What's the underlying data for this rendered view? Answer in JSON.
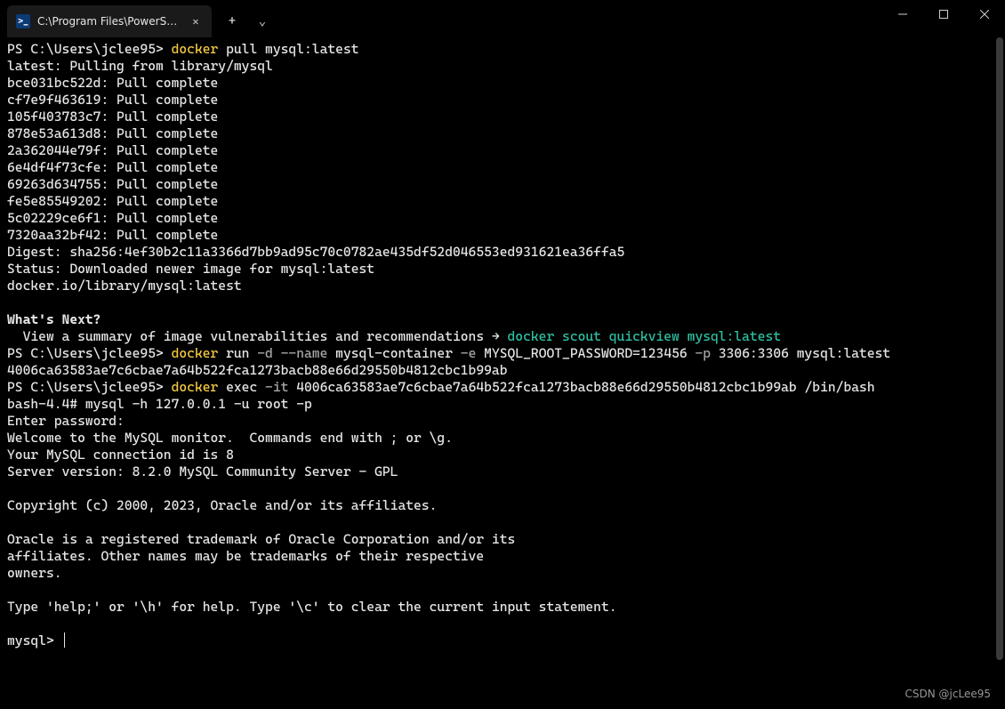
{
  "window": {
    "tab_title": "C:\\Program Files\\PowerShell\\",
    "new_tab_tooltip": "+",
    "dropdown_tooltip": "⌄"
  },
  "icons": {
    "ps_label": ">_",
    "close_x": "✕",
    "plus": "+",
    "chevron_down": "⌄"
  },
  "colors": {
    "background": "#000000",
    "text": "#e6e6e6",
    "cmd": "#f2c744",
    "flag": "#a7a7a7",
    "scout": "#2ec0a3"
  },
  "terminal": {
    "prompt": "PS C:\\Users\\jclee95> ",
    "cmd_docker": "docker",
    "cmd1_rest": " pull mysql:latest",
    "l2": "latest: Pulling from library/mysql",
    "layers": [
      "bce031bc522d: Pull complete",
      "cf7e9f463619: Pull complete",
      "105f403783c7: Pull complete",
      "878e53a613d8: Pull complete",
      "2a362044e79f: Pull complete",
      "6e4df4f73cfe: Pull complete",
      "69263d634755: Pull complete",
      "fe5e85549202: Pull complete",
      "5c02229ce6f1: Pull complete",
      "7320aa32bf42: Pull complete"
    ],
    "digest": "Digest: sha256:4ef30b2c11a3366d7bb9ad95c70c0782ae435df52d046553ed931621ea36ffa5",
    "status": "Status: Downloaded newer image for mysql:latest",
    "imgref": "docker.io/library/mysql:latest",
    "whats_next": "What's Next?",
    "scout_prefix": "  View a summary of image vulnerabilities and recommendations → ",
    "scout_cmd": "docker scout quickview mysql:latest",
    "cmd2": {
      "p1": " run ",
      "f1": "-d",
      "sp1": " ",
      "f2": "--name",
      "p2": " mysql-container ",
      "f3": "-e",
      "p3": " MYSQL_ROOT_PASSWORD=123456 ",
      "f4": "-p",
      "p4": " 3306:3306 mysql:latest"
    },
    "container_id": "4006ca63583ae7c6cbae7a64b522fca1273bacb88e66d29550b4812cbc1b99ab",
    "cmd3": {
      "p1": " exec ",
      "f1": "-it",
      "p2": " 4006ca63583ae7c6cbae7a64b522fca1273bacb88e66d29550b4812cbc1b99ab /bin/bash"
    },
    "bash_line": "bash-4.4# mysql -h 127.0.0.1 -u root -p",
    "enter_pw": "Enter password:",
    "mysql_welcome": [
      "Welcome to the MySQL monitor.  Commands end with ; or \\g.",
      "Your MySQL connection id is 8",
      "Server version: 8.2.0 MySQL Community Server - GPL",
      "",
      "Copyright (c) 2000, 2023, Oracle and/or its affiliates.",
      "",
      "Oracle is a registered trademark of Oracle Corporation and/or its",
      "affiliates. Other names may be trademarks of their respective",
      "owners.",
      "",
      "Type 'help;' or '\\h' for help. Type '\\c' to clear the current input statement.",
      ""
    ],
    "mysql_prompt": "mysql> "
  },
  "watermark": "CSDN @jcLee95"
}
